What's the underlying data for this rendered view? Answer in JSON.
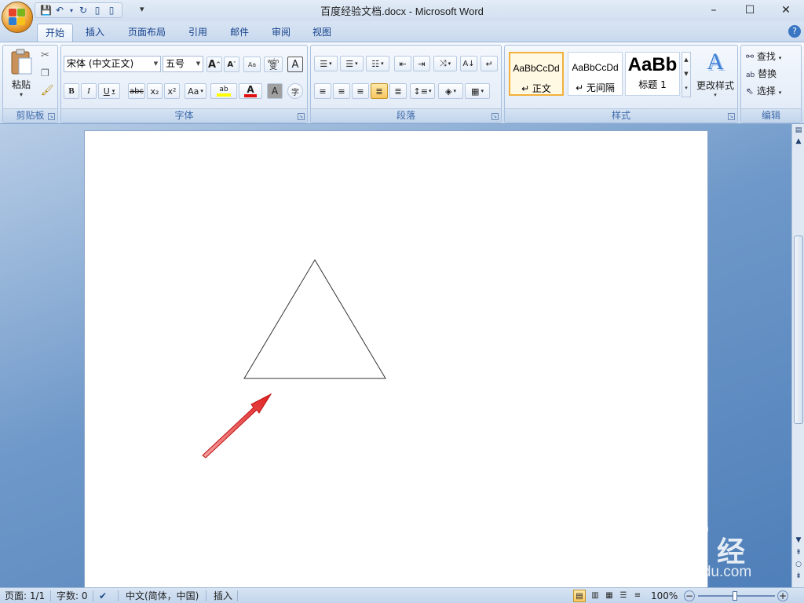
{
  "window": {
    "title": "百度经验文档.docx - Microsoft Word",
    "minimize": "–",
    "maximize": "☐",
    "close": "✕"
  },
  "qat": {
    "more": "▾"
  },
  "tabs": [
    {
      "label": "开始",
      "active": true
    },
    {
      "label": "插入"
    },
    {
      "label": "页面布局"
    },
    {
      "label": "引用"
    },
    {
      "label": "邮件"
    },
    {
      "label": "审阅"
    },
    {
      "label": "视图"
    }
  ],
  "help": "?",
  "ribbon": {
    "clipboard": {
      "label": "剪贴板",
      "paste": "粘贴",
      "paste_arrow": "▾"
    },
    "font": {
      "label": "字体",
      "font_name": "宋体 (中文正文)",
      "font_size": "五号",
      "grow": "A",
      "shrink": "A",
      "clear": "Aa",
      "wen": "wén",
      "bian": "变",
      "border_a": "A",
      "bold": "B",
      "italic": "I",
      "underline": "U",
      "strike": "abc",
      "subscript": "x₂",
      "superscript": "x²",
      "case": "Aa",
      "highlight": "ab",
      "color_a": "A",
      "shade_a": "A",
      "enclose": "字"
    },
    "paragraph": {
      "label": "段落"
    },
    "styles": {
      "label": "样式",
      "items": [
        {
          "sample": "AaBbCcDd",
          "name": "↵ 正文"
        },
        {
          "sample": "AaBbCcDd",
          "name": "↵ 无间隔"
        },
        {
          "sample": "AaBb",
          "name": "标题 1"
        }
      ],
      "change_styles": "更改样式",
      "change_icon": "A"
    },
    "editing": {
      "label": "编辑",
      "find": "查找",
      "replace": "替换",
      "select": "选择"
    }
  },
  "statusbar": {
    "page": "页面: 1/1",
    "words": "字数: 0",
    "language": "中文(简体，中国)",
    "mode": "插入",
    "zoom": "100%",
    "zoom_minus": "−",
    "zoom_plus": "+"
  },
  "watermark": {
    "brand": "Bai du 经验",
    "url": "jingyan.baidu.com"
  },
  "colors": {
    "arrow": "#e02020",
    "highlight": "#ffff00",
    "font_color": "#e01010"
  }
}
